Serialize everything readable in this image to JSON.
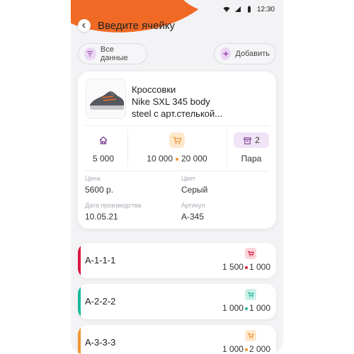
{
  "status": {
    "time": "12:30"
  },
  "header": {
    "title": "Введите ячейку"
  },
  "actions": {
    "all_data_label": "Все данные",
    "add_label": "Добавить"
  },
  "product": {
    "name_line1": "Кроссовки",
    "name_line2": "Nike SXL 345 body",
    "name_line3": "steel с арт.стелькой...",
    "stock": "5 000",
    "range_from": "10 000",
    "range_to": "20 000",
    "pack_count": "2",
    "pack_unit": "Пара",
    "fields": {
      "price_label": "Цена",
      "price_value": "5600 р.",
      "color_label": "Цвет",
      "color_value": "Серый",
      "date_label": "Дата производства",
      "date_value": "10.05.21",
      "article_label": "Артикул",
      "article_value": "А-345"
    }
  },
  "cells": [
    {
      "code": "А-1-1-1",
      "from": "1 500",
      "to": "1 000",
      "color": "#d9173f"
    },
    {
      "code": "А-2-2-2",
      "from": "1 000",
      "to": "1 000",
      "color": "#19b89a"
    },
    {
      "code": "А-3-3-3",
      "from": "1 000",
      "to": "2 000",
      "color": "#f29433"
    }
  ],
  "colors": {
    "accent": "#f06a25",
    "purple": "#7a3a91",
    "orange": "#f29433"
  },
  "icons": [
    "back-icon",
    "filter-icon",
    "plus-icon",
    "home-icon",
    "cart-icon",
    "box-icon",
    "wifi-icon",
    "signal-icon",
    "battery-icon"
  ]
}
